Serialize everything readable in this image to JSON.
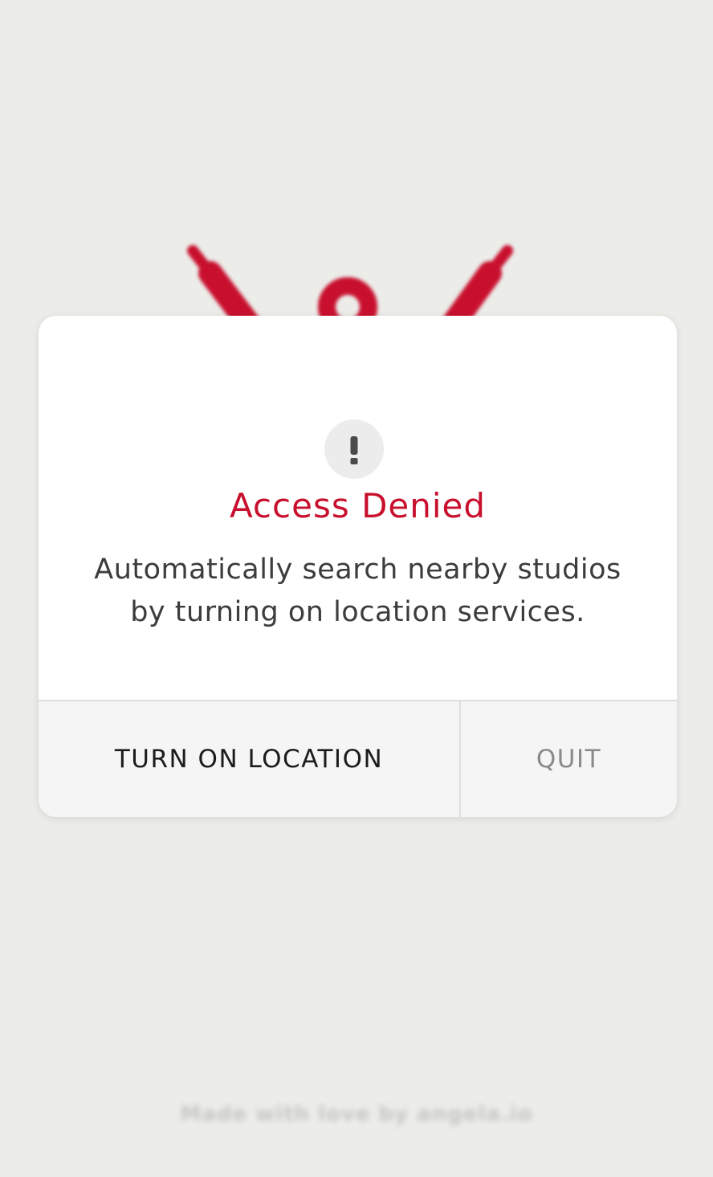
{
  "background": {
    "logo": "yoga-figure-logo",
    "footer_text": "Made with love by angela.io",
    "accent_color": "#c8102e"
  },
  "dialog": {
    "icon": "exclamation-icon",
    "title": "Access Denied",
    "message_line1": "Automatically search nearby studios",
    "message_line2": "by turning on location services.",
    "primary_button": "TURN ON LOCATION",
    "secondary_button": "QUIT"
  }
}
